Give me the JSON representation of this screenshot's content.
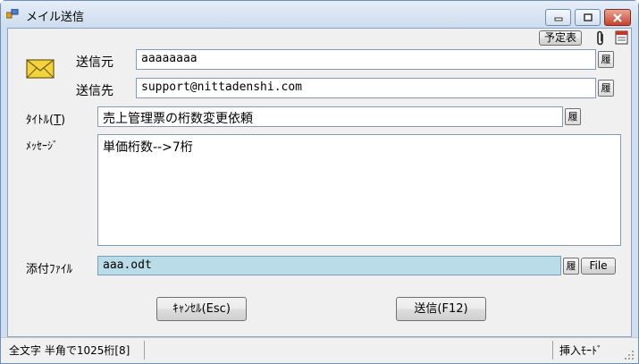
{
  "window": {
    "title": "メイル送信"
  },
  "caption_buttons": {
    "minimize": "minimize-icon",
    "maximize": "maximize-icon",
    "close": "close-icon"
  },
  "toolbar": {
    "schedule_label": "予定表",
    "attach_icon": "paperclip-icon",
    "note_icon": "note-icon"
  },
  "form": {
    "envelope_icon": "envelope-icon",
    "from_label": "送信元",
    "from_value": "aaaaaaaa",
    "to_label": "送信先",
    "to_value": "support@nittadenshi.com",
    "title_label_prefix": "ﾀｲﾄﾙ(",
    "title_label_key": "T",
    "title_label_suffix": ")",
    "title_value": "売上管理票の桁数変更依頼",
    "message_label": "ﾒｯｾｰｼﾞ",
    "message_value": "単価桁数-->7桁",
    "attachment_label": "添付ﾌｧｲﾙ",
    "attachment_value": "aaa.odt",
    "history_label": "履",
    "file_button_label": "File"
  },
  "buttons": {
    "cancel_label": "ｷｬﾝｾﾙ(Esc)",
    "send_label": "送信(F12)"
  },
  "status": {
    "left_text": "全文字 半角で1025桁[8]",
    "mode_text": "挿入ﾓｰﾄﾞ"
  },
  "colors": {
    "accent": "#b9dce8",
    "border": "#7f9db9",
    "titlebar": "#cddcee",
    "close": "#c7432d"
  }
}
